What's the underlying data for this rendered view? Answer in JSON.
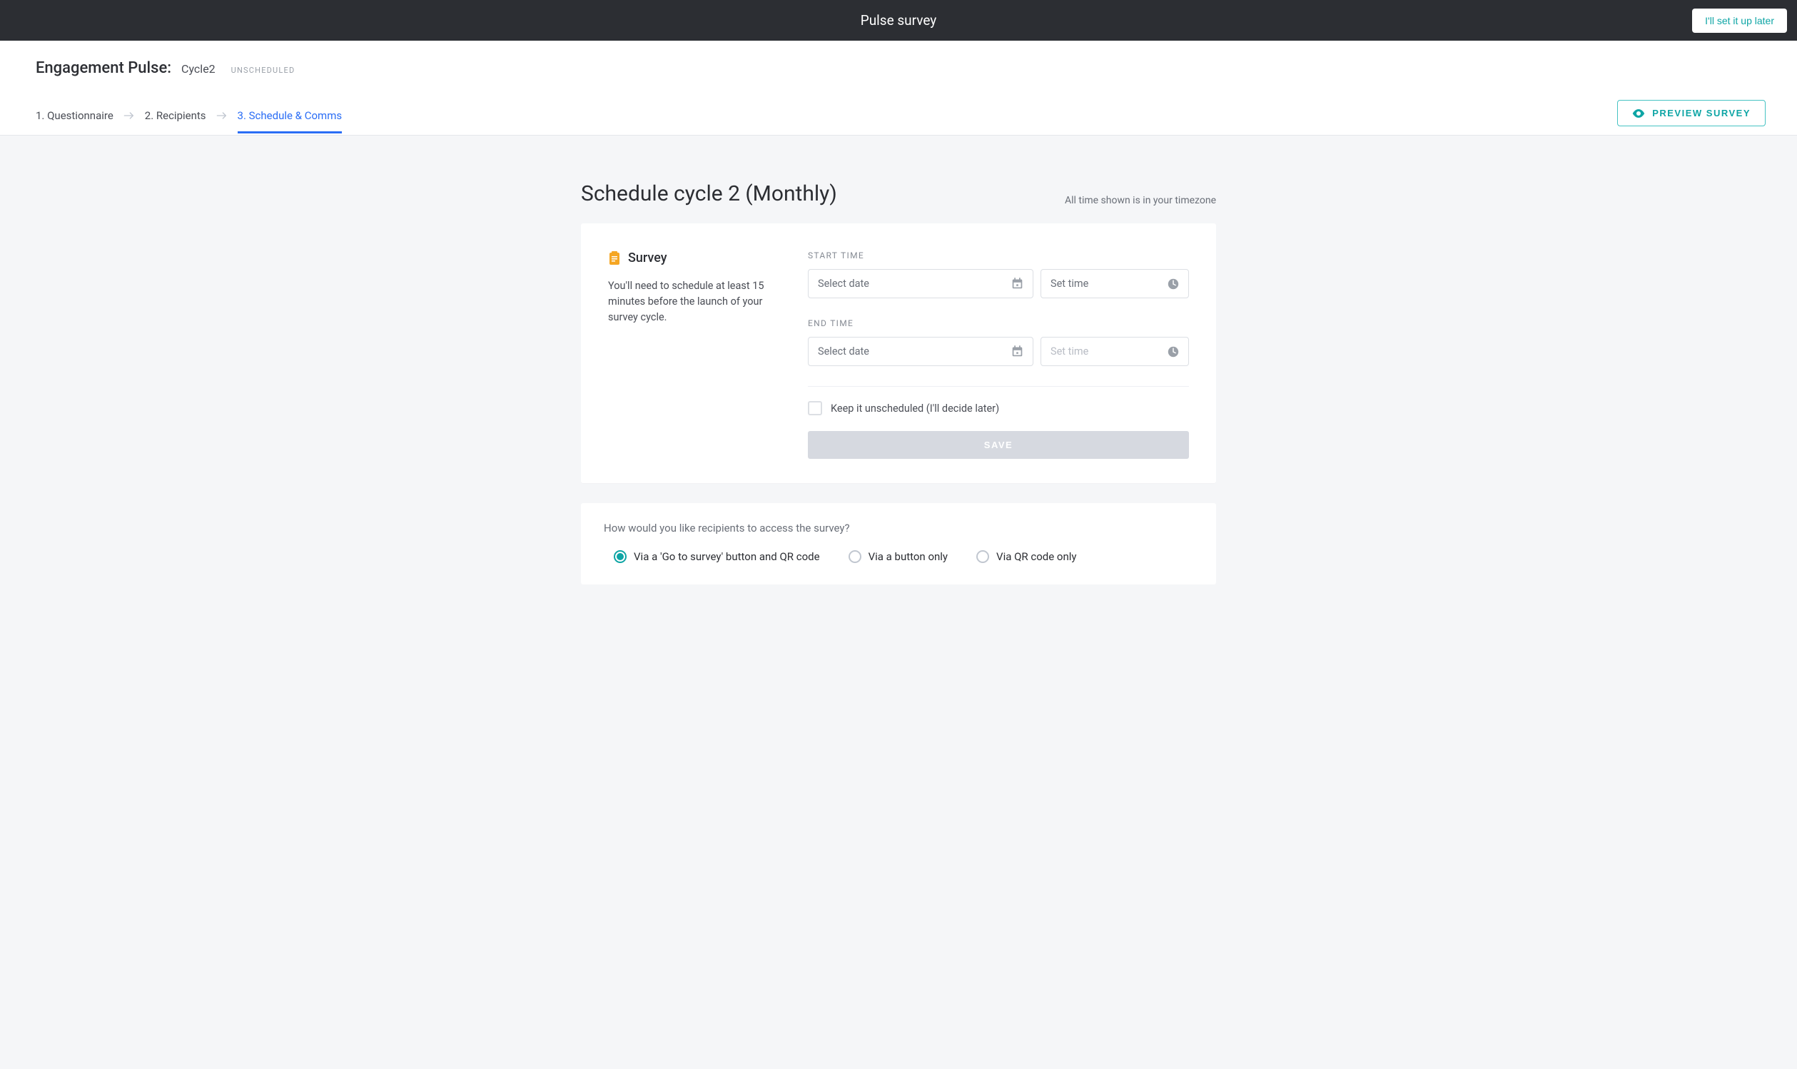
{
  "topbar": {
    "title": "Pulse survey",
    "setup_later": "I'll set it up later"
  },
  "header": {
    "survey_name": "Engagement Pulse:",
    "cycle_name": "Cycle2",
    "status": "UNSCHEDULED"
  },
  "steps": {
    "items": [
      {
        "label": "1. Questionnaire",
        "active": false
      },
      {
        "label": "2. Recipients",
        "active": false
      },
      {
        "label": "3. Schedule & Comms",
        "active": true
      }
    ],
    "preview_button": "PREVIEW SURVEY"
  },
  "page": {
    "heading": "Schedule cycle 2 (Monthly)",
    "timezone_note": "All time shown is in your timezone"
  },
  "schedule_card": {
    "section_title": "Survey",
    "section_desc": "You'll need to schedule at least 15 minutes before the launch of your survey cycle.",
    "start_label": "START TIME",
    "end_label": "END TIME",
    "date_placeholder": "Select date",
    "time_placeholder": "Set time",
    "start_date_value": "",
    "start_time_value": "",
    "end_date_value": "",
    "end_time_value": "",
    "keep_unscheduled_label": "Keep it unscheduled (I'll decide later)",
    "keep_unscheduled_checked": false,
    "save_label": "SAVE"
  },
  "access_card": {
    "question": "How would you like recipients to access the survey?",
    "options": [
      {
        "label": "Via a 'Go to survey' button and QR code",
        "checked": true
      },
      {
        "label": "Via a button only",
        "checked": false
      },
      {
        "label": "Via QR code only",
        "checked": false
      }
    ]
  },
  "colors": {
    "accent_teal": "#0ea5a5",
    "accent_blue": "#2a6df5",
    "dark_bg": "#2c2e33"
  }
}
